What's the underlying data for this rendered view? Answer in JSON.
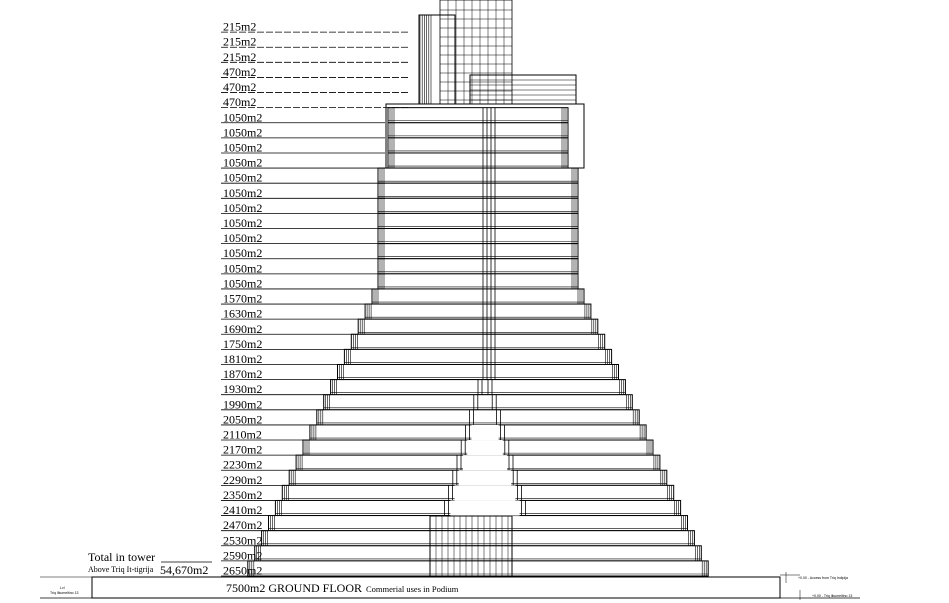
{
  "floor_areas": [
    "215m2",
    "215m2",
    "215m2",
    "470m2",
    "470m2",
    "470m2",
    "1050m2",
    "1050m2",
    "1050m2",
    "1050m2",
    "1050m2",
    "1050m2",
    "1050m2",
    "1050m2",
    "1050m2",
    "1050m2",
    "1050m2",
    "1050m2",
    "1570m2",
    "1630m2",
    "1690m2",
    "1750m2",
    "1810m2",
    "1870m2",
    "1930m2",
    "1990m2",
    "2050m2",
    "2110m2",
    "2170m2",
    "2230m2",
    "2290m2",
    "2350m2",
    "2410m2",
    "2470m2",
    "2530m2",
    "2590m2",
    "2650m2"
  ],
  "total": {
    "title": "Total in tower",
    "subtitle": "Above Triq It-tigrija",
    "value": "54,670m2"
  },
  "ground_floor": {
    "area": "7500m2 GROUND FLOOR",
    "note": "Commerial uses in Podium"
  },
  "side_notes": {
    "left_top": "Lvl",
    "left_bottom": "Triq Ilkumeltino 13",
    "right_top": "+0.00 - Access from Triq Indipija",
    "right_bottom": "+0.00 - Triq Ilkumeltino 13"
  },
  "colors": {
    "line": "#000000",
    "background": "#ffffff"
  }
}
